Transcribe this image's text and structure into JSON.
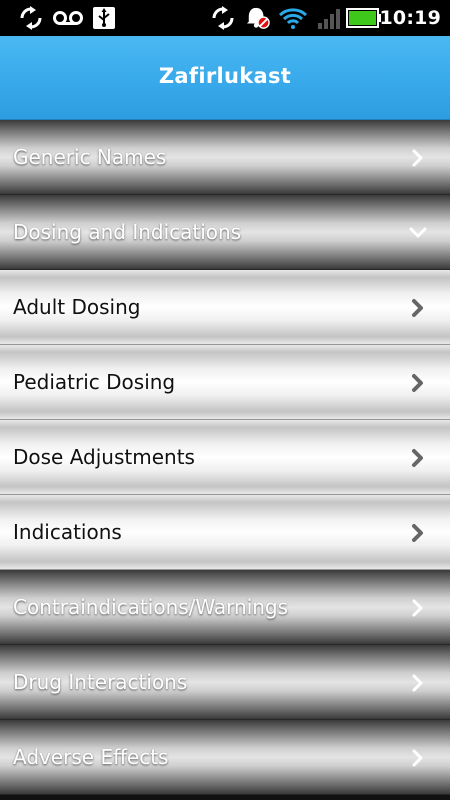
{
  "status_bar": {
    "time": "10:19",
    "icons": [
      "sync-icon",
      "voicemail-icon",
      "usb-icon",
      "sync-icon",
      "alarm-off-icon",
      "wifi-icon",
      "signal-icon",
      "battery-icon"
    ]
  },
  "header": {
    "title": "Zafirlukast"
  },
  "list": {
    "items": [
      {
        "label": "Generic Names",
        "style": "dark",
        "chevron": "right"
      },
      {
        "label": "Dosing and Indications",
        "style": "dark",
        "chevron": "down"
      },
      {
        "label": "Adult Dosing",
        "style": "light",
        "chevron": "right"
      },
      {
        "label": "Pediatric Dosing",
        "style": "light",
        "chevron": "right"
      },
      {
        "label": "Dose Adjustments",
        "style": "light",
        "chevron": "right"
      },
      {
        "label": "Indications",
        "style": "light",
        "chevron": "right"
      },
      {
        "label": "Contraindications/Warnings",
        "style": "dark",
        "chevron": "right"
      },
      {
        "label": "Drug Interactions",
        "style": "dark",
        "chevron": "right"
      },
      {
        "label": "Adverse Effects",
        "style": "dark",
        "chevron": "right"
      }
    ]
  },
  "colors": {
    "header_blue": "#38a9ea",
    "battery_green": "#3ec81c",
    "wifi_blue": "#2aa9e6",
    "alarm_off_red": "#e01010"
  }
}
